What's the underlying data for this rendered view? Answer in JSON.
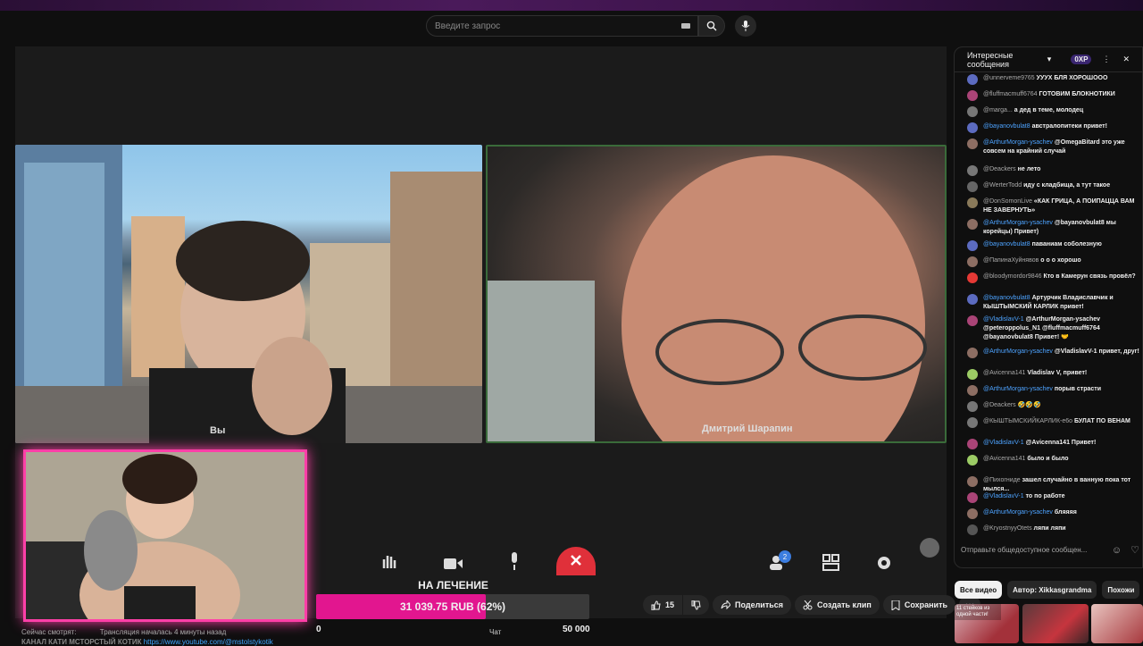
{
  "search": {
    "placeholder": "Введите запрос"
  },
  "tiles": {
    "left_name": "Вы",
    "right_name": "Дмитрий Шарапин"
  },
  "call_controls": {
    "badge_count": "2"
  },
  "goal": {
    "title": "НА ЛЕЧЕНИЕ",
    "amount_text": "31 039.75 RUB (62%)",
    "progress_fraction": 0.62,
    "scale_min": "0",
    "scale_max": "50 000",
    "tab_label": "Чат"
  },
  "description": {
    "line1_prefix": "Сейчас смотрят:",
    "line1_rest": "Трансляция началась 4 минуты назад",
    "line2_prefix": "КАНАЛ КАТИ МСТОРСТЫЙ КОТИК",
    "line2_link": "https://www.youtube.com/@mstolstykotik"
  },
  "actions": {
    "likes": "15",
    "share": "Поделиться",
    "clip": "Создать клип",
    "save": "Сохранить"
  },
  "chat": {
    "header": "Интересные сообщения",
    "xp_badge": "0XP",
    "input_placeholder": "Отправьте общедоступное сообщен...",
    "messages": [
      {
        "user": "@unnerveme9765",
        "text": "УУУХ БЛЯ ХОРОШООО",
        "color": "#5c6bc0",
        "blue": false
      },
      {
        "user": "@fluffmacmuff6764",
        "text": "ГОТОВИМ БЛОКНОТИКИ",
        "color": "#a47",
        "blue": false
      },
      {
        "user": "@marga...",
        "text": "а дед в теме, молодец",
        "color": "#777",
        "blue": false
      },
      {
        "user": "@bayanovbulat8",
        "text": "австралопитеки привет!",
        "color": "#5c6bc0",
        "blue": true
      },
      {
        "user": "@ArthurMorgan-ysachev",
        "text": "@OmegaBitard это уже совсем на крайний случай",
        "color": "#8d6e63",
        "blue": true
      },
      {
        "user": "@Deackers",
        "text": "не лето",
        "color": "#777",
        "blue": false
      },
      {
        "user": "@WerterTodd",
        "text": "иду с кладбища, а тут такое",
        "color": "#666",
        "blue": false
      },
      {
        "user": "@DonSomonLive",
        "text": "«КАК ГРИЦА, А ПОИПАЦЦА ВАМ НЕ ЗАВЕРНУТЬ»",
        "color": "#8a7a5a",
        "blue": false
      },
      {
        "user": "@ArthurMorgan-ysachev",
        "text": "@bayanovbulat8 мы корейцы) Привет)",
        "color": "#8d6e63",
        "blue": true
      },
      {
        "user": "@bayanovbulat8",
        "text": "паваниам соболезную",
        "color": "#5c6bc0",
        "blue": true
      },
      {
        "user": "@ПапинаХуйнявов",
        "text": "о о о хорошо",
        "color": "#8d6e63",
        "blue": false
      },
      {
        "user": "@bloodymordor9846",
        "text": "Кто в Камерун связь провёл?",
        "color": "#e53935",
        "blue": false
      },
      {
        "user": "@bayanovbulat8",
        "text": "Артурчик Владиславчик и КЫШТЫМСКИЙ КАРЛИК привет!",
        "color": "#5c6bc0",
        "blue": true
      },
      {
        "user": "@VladislavV-1",
        "text": "@ArthurMorgan-ysachev @peteroppolus_N1 @fluffmacmuff6764 @bayanovbulat8 Привет! 🤝",
        "color": "#a47",
        "blue": true
      },
      {
        "user": "@ArthurMorgan-ysachev",
        "text": "@VladislavV-1 привет, друг!",
        "color": "#8d6e63",
        "blue": true
      },
      {
        "user": "@Avicenna141",
        "text": "Vladislav V, привет!",
        "color": "#9ccc65",
        "blue": false
      },
      {
        "user": "@ArthurMorgan-ysachev",
        "text": "порыв страсти",
        "color": "#8d6e63",
        "blue": true
      },
      {
        "user": "@Deackers",
        "text": "🤣🤣🤣",
        "color": "#777",
        "blue": false
      },
      {
        "user": "@КЫШТЫМСКИЙКАРЛИК-e6o",
        "text": "БУЛАТ ПО ВЕНАМ",
        "color": "#777",
        "blue": false
      },
      {
        "user": "@VladislavV-1",
        "text": "@Avicenna141 Привет!",
        "color": "#a47",
        "blue": true
      },
      {
        "user": "@Avicenna141",
        "text": "было и было",
        "color": "#9ccc65",
        "blue": false
      },
      {
        "user": "@Пихогниде",
        "text": "зашел случайно в ванную пока тот мылся...",
        "color": "#8d6e63",
        "blue": false
      },
      {
        "user": "@VladislavV-1",
        "text": "то по работе",
        "color": "#a47",
        "blue": true
      },
      {
        "user": "@ArthurMorgan-ysachev",
        "text": "бляяяя",
        "color": "#8d6e63",
        "blue": true
      },
      {
        "user": "@KryostnyyOtets",
        "text": "ляпи ляпи",
        "color": "#555",
        "blue": false
      }
    ]
  },
  "related_tabs": [
    "Все видео",
    "Автор: Xikkasgrandma",
    "Похожи"
  ],
  "thumb_caption": "11 стейков из одной части!"
}
